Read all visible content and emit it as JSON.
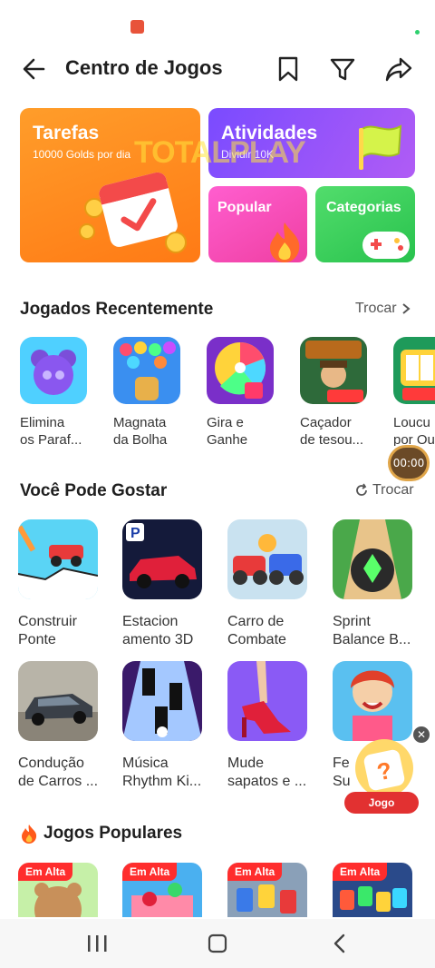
{
  "header": {
    "title": "Centro de Jogos"
  },
  "banners": {
    "tarefas_title": "Tarefas",
    "tarefas_sub": "10000 Golds por dia",
    "atividades_title": "Atividades",
    "atividades_sub": "Dividir 10K",
    "popular_title": "Popular",
    "categorias_title": "Categorias",
    "watermark": "TOTALPLAY"
  },
  "recent": {
    "title": "Jogados Recentemente",
    "link": "Trocar",
    "items": [
      {
        "label": "Elimina\nos Paraf..."
      },
      {
        "label": "Magnata\nda Bolha"
      },
      {
        "label": "Gira e\nGanhe"
      },
      {
        "label": "Caçador\nde tesou..."
      },
      {
        "label": "Loucu\npor Ou"
      }
    ]
  },
  "timer": "00:00",
  "suggest": {
    "title": "Você Pode Gostar",
    "link": "Trocar",
    "items": [
      {
        "label": "Construir\nPonte"
      },
      {
        "label": "Estacion\namento 3D"
      },
      {
        "label": "Carro de\nCombate"
      },
      {
        "label": "Sprint\nBalance B..."
      },
      {
        "label": "Condução\nde Carros ..."
      },
      {
        "label": "Música\nRhythm Ki..."
      },
      {
        "label": "Mude\nsapatos e ..."
      },
      {
        "label": "Fe\nSu"
      }
    ]
  },
  "float_game": {
    "label": "Jogo"
  },
  "popular": {
    "title": "Jogos Populares",
    "badge": "Em Alta"
  },
  "colors": {
    "tarefas": "#ff8a1f",
    "atividades": "#8b4dfa",
    "popular": "#f44fb6",
    "categorias": "#3ccf5a",
    "badge": "#ff2d2d"
  }
}
